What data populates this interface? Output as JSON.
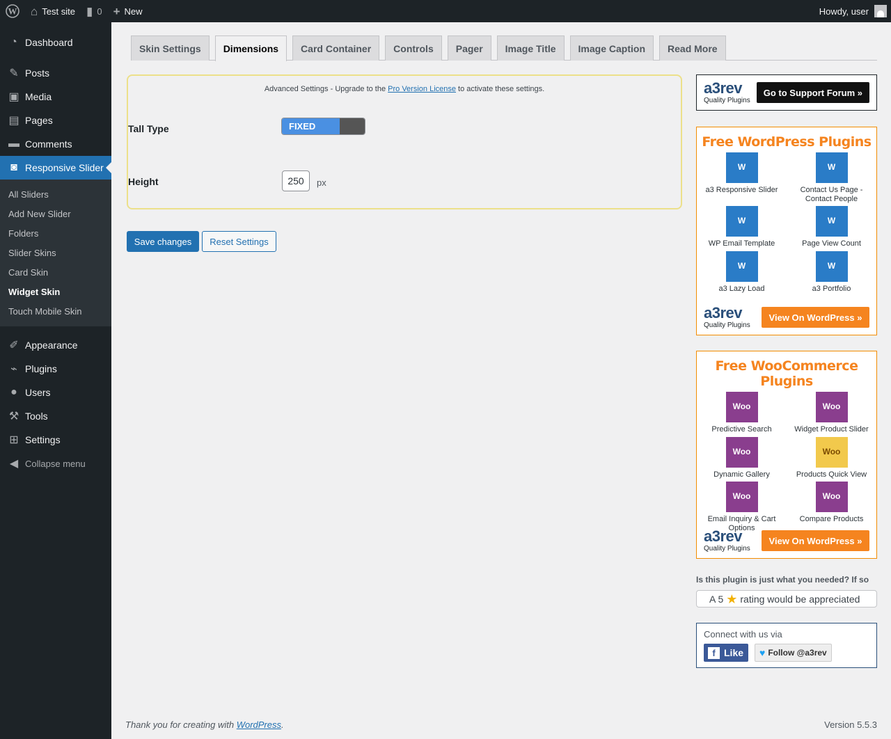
{
  "adminbar": {
    "site_name": "Test site",
    "comments_count": "0",
    "new_label": "New",
    "greeting": "Howdy, user"
  },
  "sidebar": {
    "items_top": [
      {
        "label": "Dashboard",
        "icon": "dashboard-icon"
      },
      {
        "label": "Posts",
        "icon": "pin-icon"
      },
      {
        "label": "Media",
        "icon": "media-icon"
      },
      {
        "label": "Pages",
        "icon": "pages-icon"
      },
      {
        "label": "Comments",
        "icon": "comments-icon"
      },
      {
        "label": "Responsive Slider",
        "icon": "camera-icon"
      }
    ],
    "submenu": [
      "All Sliders",
      "Add New Slider",
      "Folders",
      "Slider Skins",
      "Card Skin",
      "Widget Skin",
      "Touch Mobile Skin"
    ],
    "items_bottom": [
      {
        "label": "Appearance",
        "icon": "brush-icon"
      },
      {
        "label": "Plugins",
        "icon": "plugin-icon"
      },
      {
        "label": "Users",
        "icon": "users-icon"
      },
      {
        "label": "Tools",
        "icon": "wrench-icon"
      },
      {
        "label": "Settings",
        "icon": "settings-icon"
      }
    ],
    "collapse_label": "Collapse menu"
  },
  "tabs": [
    "Skin Settings",
    "Dimensions",
    "Card Container",
    "Controls",
    "Pager",
    "Image Title",
    "Image Caption",
    "Read More"
  ],
  "active_tab": "Dimensions",
  "settings": {
    "notice_before": "Advanced Settings - Upgrade to the ",
    "notice_link": "Pro Version License",
    "notice_after": " to activate these settings.",
    "tall_type_label": "Tall Type",
    "tall_type_value": "FIXED",
    "height_label": "Height",
    "height_value": "250",
    "height_unit": "px"
  },
  "buttons": {
    "save": "Save changes",
    "reset": "Reset Settings"
  },
  "support": {
    "logo_big": "a3rev",
    "logo_small": "Quality Plugins",
    "button": "Go to Support Forum »"
  },
  "wp_plugins": {
    "title": "Free WordPress Plugins",
    "items": [
      "a3 Responsive Slider",
      "Contact Us Page - Contact People",
      "WP Email Template",
      "Page View Count",
      "a3 Lazy Load",
      "a3 Portfolio"
    ],
    "button": "View On WordPress »"
  },
  "woo_plugins": {
    "title": "Free WooCommerce Plugins",
    "items": [
      "Predictive Search",
      "Widget Product Slider",
      "Dynamic Gallery",
      "Products Quick View",
      "Email Inquiry & Cart Options",
      "Compare Products"
    ],
    "button": "View On WordPress »"
  },
  "rating": {
    "question": "Is this plugin is just what you needed? If so",
    "prefix": "A 5",
    "suffix": "rating would be appreciated"
  },
  "connect": {
    "title": "Connect with us via",
    "fb": "Like",
    "tw": "Follow @a3rev"
  },
  "footer": {
    "thanks_prefix": "Thank you for creating with ",
    "thanks_link": "WordPress",
    "thanks_suffix": ".",
    "version": "Version 5.5.3"
  },
  "colors": {
    "admin_bg": "#1d2327",
    "accent": "#2271b1",
    "orange": "#f5841f",
    "notice_border": "#ece08a"
  }
}
